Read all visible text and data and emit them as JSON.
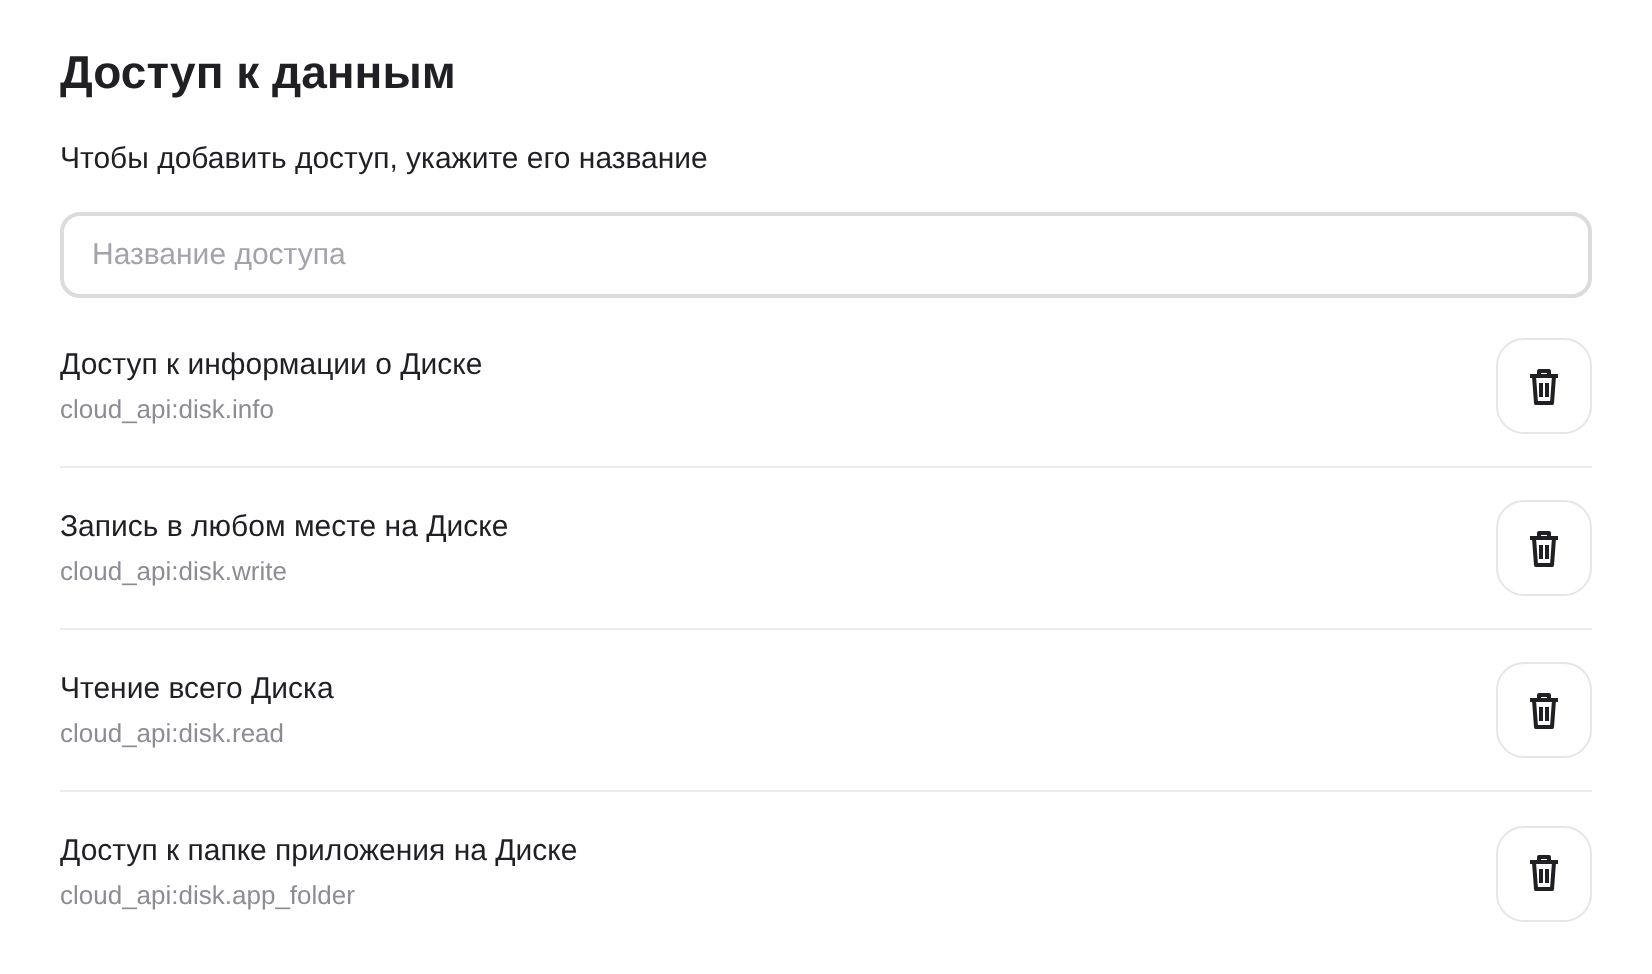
{
  "title": "Доступ к данным",
  "hint": "Чтобы добавить доступ, укажите его название",
  "search": {
    "placeholder": "Название доступа"
  },
  "permissions": [
    {
      "name": "Доступ к информации о Диске",
      "code": "cloud_api:disk.info"
    },
    {
      "name": "Запись в любом месте на Диске",
      "code": "cloud_api:disk.write"
    },
    {
      "name": "Чтение всего Диска",
      "code": "cloud_api:disk.read"
    },
    {
      "name": "Доступ к папке приложения на Диске",
      "code": "cloud_api:disk.app_folder"
    }
  ]
}
